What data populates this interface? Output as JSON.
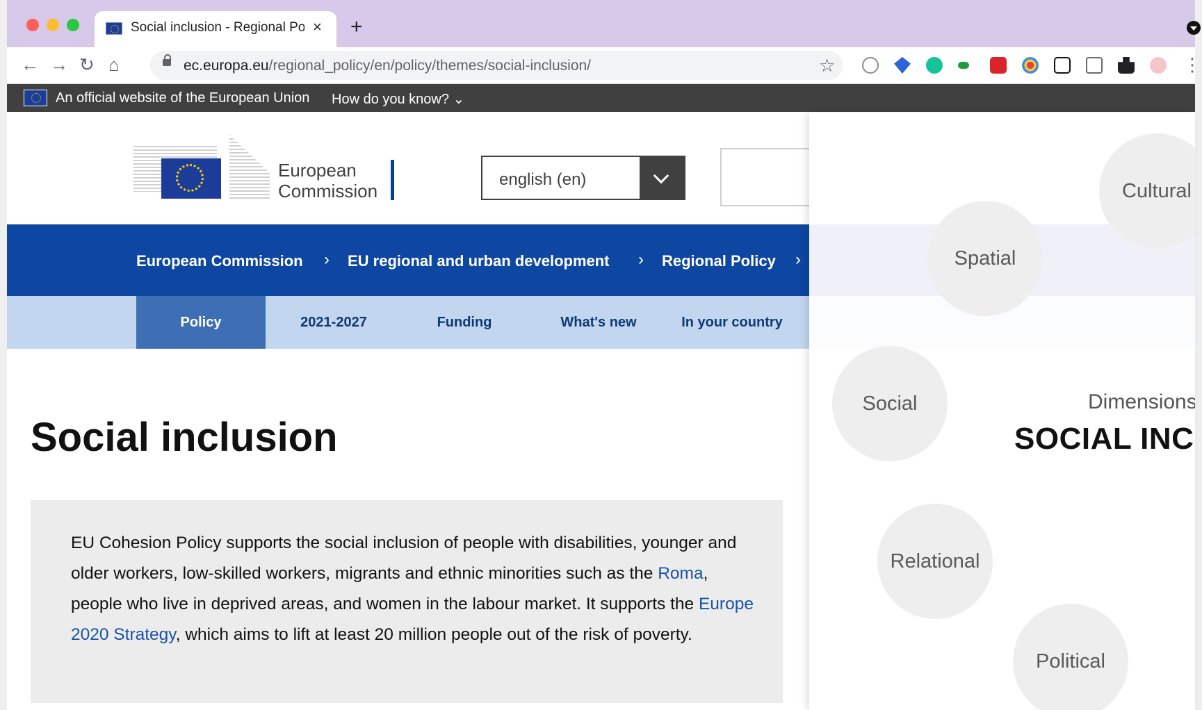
{
  "browser": {
    "tab_title": "Social inclusion - Regional Poli",
    "url_host": "ec.europa.eu",
    "url_path": "/regional_policy/en/policy/themes/social-inclusion/",
    "new_tab_label": "+",
    "close_label": "×"
  },
  "eu_banner": {
    "text": "An official website of the European Union",
    "how_know": "How do you know? ⌄"
  },
  "header": {
    "logo_line1": "European",
    "logo_line2": "Commission",
    "language": "english (en)"
  },
  "breadcrumb": [
    "European Commission",
    "EU regional and urban development",
    "Regional Policy"
  ],
  "subnav": [
    "Policy",
    "2021-2027",
    "Funding",
    "What's new",
    "In your country"
  ],
  "main": {
    "title": "Social inclusion",
    "intro_1": "EU Cohesion Policy supports the social inclusion of people with disabilities, younger and older workers, low-skilled workers, migrants and ethnic minorities such as the ",
    "intro_link_roma": "Roma",
    "intro_2": ", people who live in deprived areas, and women in the labour market. It supports the ",
    "intro_link_strategy": "Europe 2020 Strategy",
    "intro_3": ", which aims to lift at least 20 million people out of the risk of poverty."
  },
  "overlay": {
    "bubbles": [
      "Cultural",
      "Spatial",
      "Social",
      "Relational",
      "Political"
    ],
    "dimensions_label": "Dimensions",
    "title": "SOCIAL INCL"
  }
}
